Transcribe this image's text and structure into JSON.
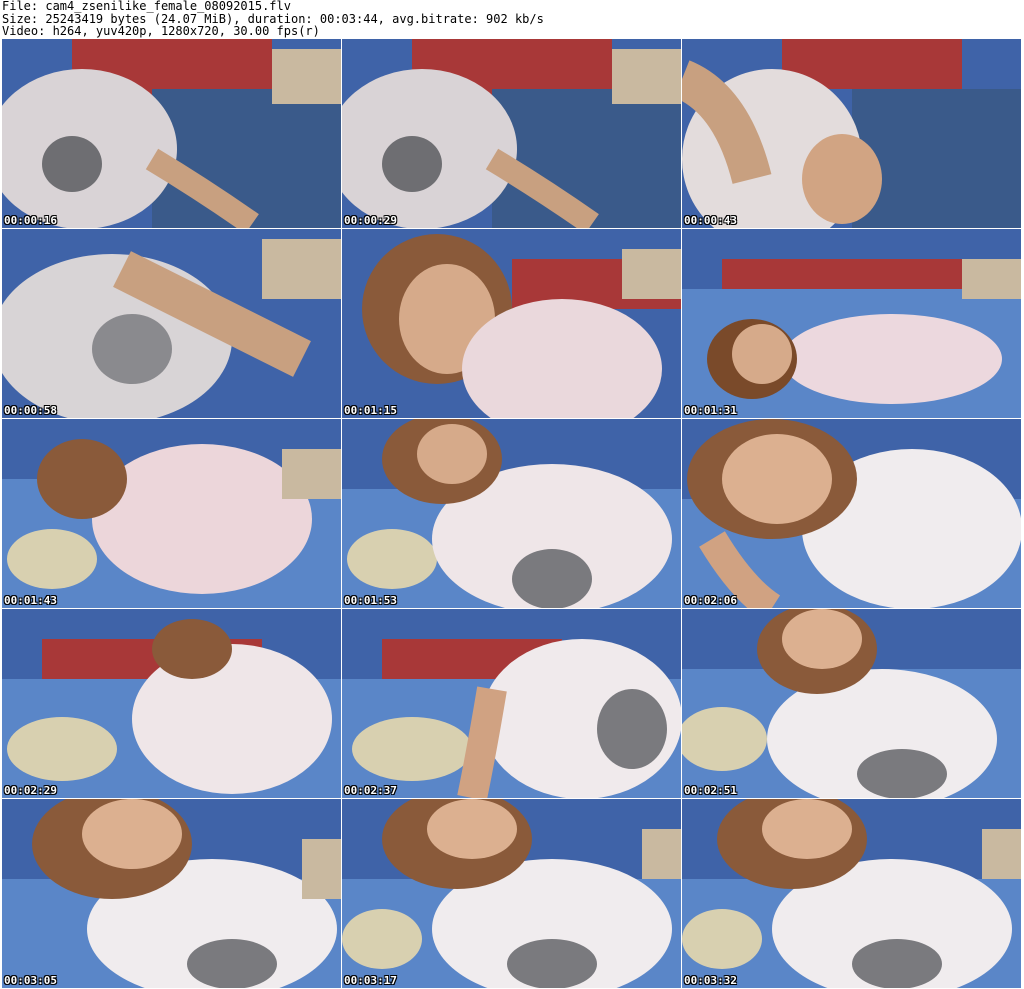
{
  "header": {
    "file_line": "File: cam4_zsenilike_female_08092015.flv",
    "size_line": "Size: 25243419 bytes (24.07 MiB), duration: 00:03:44, avg.bitrate: 902 kb/s",
    "video_line": "Video: h264, yuv420p, 1280x720, 30.00 fps(r)"
  },
  "thumbnails": [
    {
      "timestamp": "00:00:16"
    },
    {
      "timestamp": "00:00:29"
    },
    {
      "timestamp": "00:00:43"
    },
    {
      "timestamp": "00:00:58"
    },
    {
      "timestamp": "00:01:15"
    },
    {
      "timestamp": "00:01:31"
    },
    {
      "timestamp": "00:01:43"
    },
    {
      "timestamp": "00:01:53"
    },
    {
      "timestamp": "00:02:06"
    },
    {
      "timestamp": "00:02:29"
    },
    {
      "timestamp": "00:02:37"
    },
    {
      "timestamp": "00:02:51"
    },
    {
      "timestamp": "00:03:05"
    },
    {
      "timestamp": "00:03:17"
    },
    {
      "timestamp": "00:03:32"
    }
  ]
}
